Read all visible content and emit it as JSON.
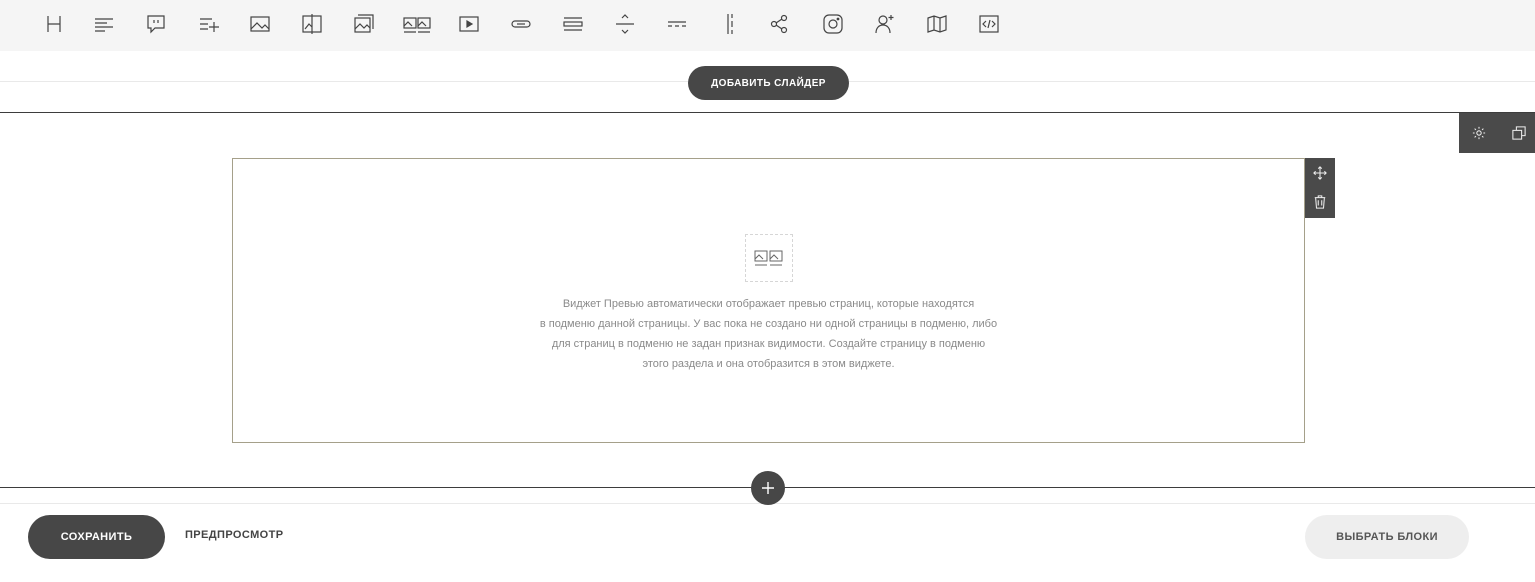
{
  "toolbar": {
    "tools": [
      {
        "icon": "heading-icon"
      },
      {
        "icon": "text-icon"
      },
      {
        "icon": "quote-icon"
      },
      {
        "icon": "list-icon"
      },
      {
        "icon": "image-icon"
      },
      {
        "icon": "image-compare-icon"
      },
      {
        "icon": "image-text-icon"
      },
      {
        "icon": "gallery-icon"
      },
      {
        "icon": "video-icon"
      },
      {
        "icon": "button-icon"
      },
      {
        "icon": "spacer-icon"
      },
      {
        "icon": "divider-icon"
      },
      {
        "icon": "dashed-divider-icon"
      },
      {
        "icon": "vertical-divider-icon"
      },
      {
        "icon": "share-icon"
      },
      {
        "icon": "instagram-icon"
      },
      {
        "icon": "add-user-icon"
      },
      {
        "icon": "map-icon"
      },
      {
        "icon": "code-icon"
      }
    ]
  },
  "slider": {
    "add_label": "ДОБАВИТЬ СЛАЙДЕР"
  },
  "widget": {
    "icon": "gallery-icon",
    "message_lines": [
      "Виджет Превью автоматически отображает превью страниц, которые находятся",
      "в подменю данной страницы. У вас пока не создано ни одной страницы в подменю, либо",
      "для страниц в подменю не задан признак видимости. Создайте страницу в подменю",
      "этого раздела и она отобразится в этом виджете."
    ]
  },
  "footer": {
    "save_label": "СОХРАНИТЬ",
    "preview_label": "ПРЕДПРОСМОТР",
    "choose_blocks_label": "ВЫБРАТЬ БЛОКИ"
  },
  "colors": {
    "dark": "#474747",
    "frame": "#a5a08a",
    "toolbar_bg": "#f5f5f5",
    "muted_text": "#8a8a8a"
  }
}
